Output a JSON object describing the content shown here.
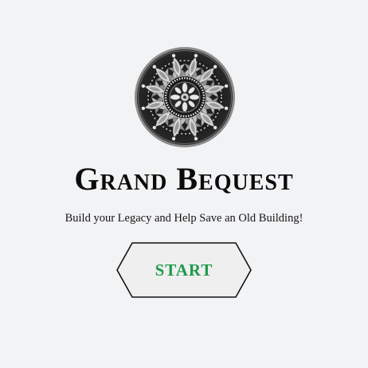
{
  "game": {
    "title": "Grand Bequest",
    "subtitle": "Build your Legacy and Help Save an Old Building!",
    "emblem_icon": "ornate-medallion-icon"
  },
  "start_button": {
    "label": "START",
    "text_color": "#1e9a4b",
    "fill_color": "#efefef",
    "border_color": "#111111"
  },
  "colors": {
    "background": "#f2f3f5",
    "title": "#0b0b0b"
  }
}
